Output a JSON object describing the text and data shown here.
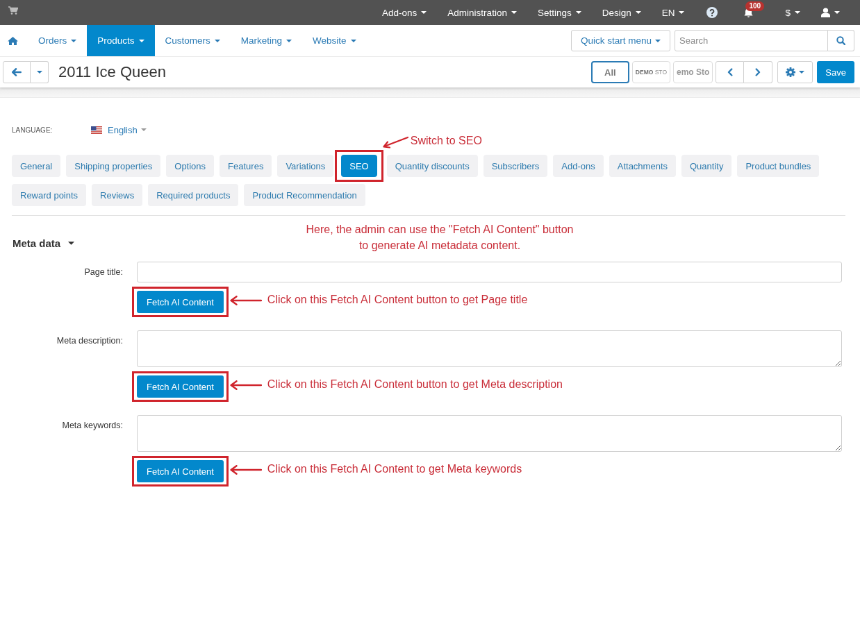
{
  "top_bar": {
    "menus": [
      "Add-ons",
      "Administration",
      "Settings",
      "Design",
      "EN"
    ],
    "notifications": {
      "count": "100"
    },
    "currency": "$"
  },
  "main_nav": {
    "items": [
      {
        "label": "Orders",
        "selected": false
      },
      {
        "label": "Products",
        "selected": true
      },
      {
        "label": "Customers",
        "selected": false
      },
      {
        "label": "Marketing",
        "selected": false
      },
      {
        "label": "Website",
        "selected": false
      }
    ],
    "quick_start": "Quick start menu",
    "search": {
      "placeholder": "Search"
    }
  },
  "toolbar": {
    "title": "2011 Ice Queen",
    "storefronts": [
      {
        "label": "All",
        "kind": "text",
        "selected": true
      },
      {
        "label": "**DEMO** STO",
        "kind": "logo",
        "selected": false
      },
      {
        "label": "emo Sto",
        "kind": "wordmark",
        "selected": false
      }
    ],
    "save": "Save"
  },
  "language": {
    "label": "LANGUAGE:",
    "value": "English"
  },
  "tabs": [
    {
      "label": "General",
      "selected": false
    },
    {
      "label": "Shipping properties",
      "selected": false
    },
    {
      "label": "Options",
      "selected": false
    },
    {
      "label": "Features",
      "selected": false
    },
    {
      "label": "Variations",
      "selected": false
    },
    {
      "label": "SEO",
      "selected": true,
      "callout": "Switch to SEO"
    },
    {
      "label": "Quantity discounts",
      "selected": false
    },
    {
      "label": "Subscribers",
      "selected": false
    },
    {
      "label": "Add-ons",
      "selected": false
    },
    {
      "label": "Attachments",
      "selected": false
    },
    {
      "label": "Quantity",
      "selected": false
    },
    {
      "label": "Product bundles",
      "selected": false
    },
    {
      "label": "Reward points",
      "selected": false
    },
    {
      "label": "Reviews",
      "selected": false
    },
    {
      "label": "Required products",
      "selected": false
    },
    {
      "label": "Product Recommendation",
      "selected": false
    }
  ],
  "meta_section": {
    "title": "Meta data",
    "expanded": true,
    "note": "Here, the admin can use the \"Fetch AI Content\" button\nto generate AI metadata content."
  },
  "fields": [
    {
      "label": "Page title:",
      "kind": "input",
      "button": "Fetch AI Content",
      "callout": "Click on this Fetch AI Content button to get Page title"
    },
    {
      "label": "Meta description:",
      "kind": "textarea",
      "button": "Fetch AI Content",
      "callout": "Click on this Fetch AI Content button to get Meta description"
    },
    {
      "label": "Meta keywords:",
      "kind": "textarea",
      "button": "Fetch AI Content",
      "callout": "Click on this Fetch AI Content to get Meta keywords"
    }
  ]
}
